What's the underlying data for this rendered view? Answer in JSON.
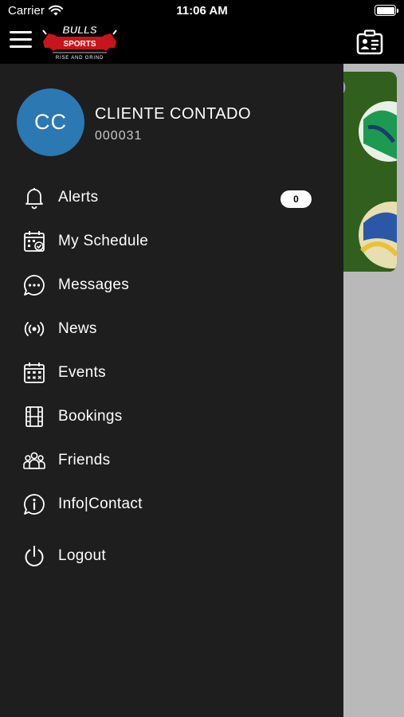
{
  "status_bar": {
    "carrier": "Carrier",
    "time": "11:06 AM"
  },
  "app_bar": {
    "logo": {
      "title": "BULLS",
      "subtitle": "SPORTS",
      "tagline": "RISE AND GRIND"
    }
  },
  "colors": {
    "avatar": "#2b78b3",
    "drawer_bg": "#1e1e1e",
    "brand_red": "#c8141c"
  },
  "profile": {
    "initials": "CC",
    "name": "CLIENTE CONTADO",
    "code": "000031"
  },
  "menu": {
    "items": [
      {
        "label": "Alerts",
        "icon": "bell-icon",
        "badge": "0"
      },
      {
        "label": "My Schedule",
        "icon": "schedule-calendar-icon"
      },
      {
        "label": "Messages",
        "icon": "chat-bubble-icon"
      },
      {
        "label": "News",
        "icon": "broadcast-icon"
      },
      {
        "label": "Events",
        "icon": "events-calendar-icon"
      },
      {
        "label": "Bookings",
        "icon": "bookings-film-icon"
      },
      {
        "label": "Friends",
        "icon": "friends-group-icon"
      },
      {
        "label": "Info|Contact",
        "icon": "info-bubble-icon"
      },
      {
        "label": "Logout",
        "icon": "power-icon"
      }
    ]
  }
}
